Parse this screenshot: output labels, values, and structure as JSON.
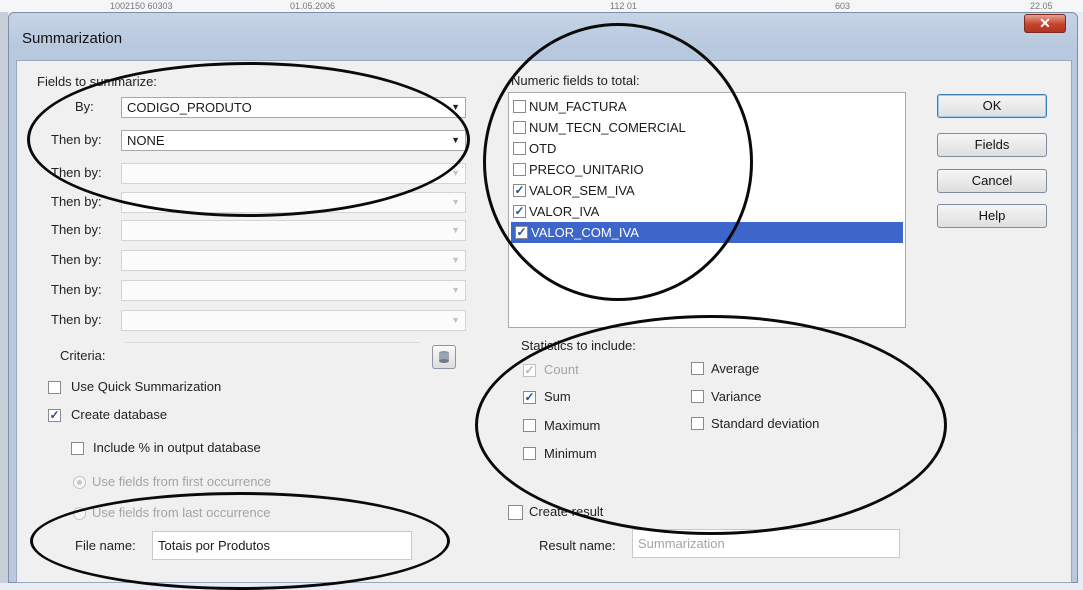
{
  "background_strip": [
    "1002150  60303",
    "01.05.2006",
    "112  01",
    "603",
    "22.05"
  ],
  "window": {
    "title": "Summarization",
    "close_glyph": "✕"
  },
  "fields_to_summarize": {
    "heading": "Fields to summarize:",
    "rows": [
      {
        "label": "By:",
        "value": "CODIGO_PRODUTO",
        "enabled": true
      },
      {
        "label": "Then by:",
        "value": "NONE",
        "enabled": true
      },
      {
        "label": "Then by:",
        "value": "",
        "enabled": false
      },
      {
        "label": "Then by:",
        "value": "",
        "enabled": false
      },
      {
        "label": "Then by:",
        "value": "",
        "enabled": false
      },
      {
        "label": "Then by:",
        "value": "",
        "enabled": false
      },
      {
        "label": "Then by:",
        "value": "",
        "enabled": false
      },
      {
        "label": "Then by:",
        "value": "",
        "enabled": false
      }
    ]
  },
  "criteria": {
    "label": "Criteria:",
    "value": ""
  },
  "options": {
    "quick_summarization": {
      "label": "Use Quick Summarization",
      "checked": false
    },
    "create_database": {
      "label": "Create database",
      "checked": true
    },
    "include_percent": {
      "label": "Include % in output database",
      "checked": false
    },
    "first_occurrence": {
      "label": "Use fields from first occurrence",
      "selected": true
    },
    "last_occurrence": {
      "label": "Use fields from last occurrence",
      "selected": false
    }
  },
  "file_name": {
    "label": "File name:",
    "value": "Totais por Produtos"
  },
  "numeric_fields": {
    "heading": "Numeric fields to total:",
    "items": [
      {
        "label": "NUM_FACTURA",
        "checked": false,
        "selected": false
      },
      {
        "label": "NUM_TECN_COMERCIAL",
        "checked": false,
        "selected": false
      },
      {
        "label": "OTD",
        "checked": false,
        "selected": false
      },
      {
        "label": "PRECO_UNITARIO",
        "checked": false,
        "selected": false
      },
      {
        "label": "VALOR_SEM_IVA",
        "checked": true,
        "selected": false
      },
      {
        "label": "VALOR_IVA",
        "checked": true,
        "selected": false
      },
      {
        "label": "VALOR_COM_IVA",
        "checked": true,
        "selected": true
      }
    ]
  },
  "statistics": {
    "heading": "Statistics to include:",
    "count": {
      "label": "Count",
      "checked": true,
      "enabled": false
    },
    "sum": {
      "label": "Sum",
      "checked": true,
      "enabled": true
    },
    "maximum": {
      "label": "Maximum",
      "checked": false,
      "enabled": true
    },
    "minimum": {
      "label": "Minimum",
      "checked": false,
      "enabled": true
    },
    "average": {
      "label": "Average",
      "checked": false,
      "enabled": true
    },
    "variance": {
      "label": "Variance",
      "checked": false,
      "enabled": true
    },
    "std_dev": {
      "label": "Standard deviation",
      "checked": false,
      "enabled": true
    }
  },
  "create_result": {
    "label": "Create result",
    "checked": false
  },
  "result_name": {
    "label": "Result name:",
    "value": "Summarization"
  },
  "buttons": {
    "ok": "OK",
    "fields": "Fields",
    "cancel": "Cancel",
    "help": "Help"
  },
  "colors": {
    "selection": "#3c66c9",
    "check": "#2d4f91",
    "annotation_ring": "#0a0a0a"
  }
}
